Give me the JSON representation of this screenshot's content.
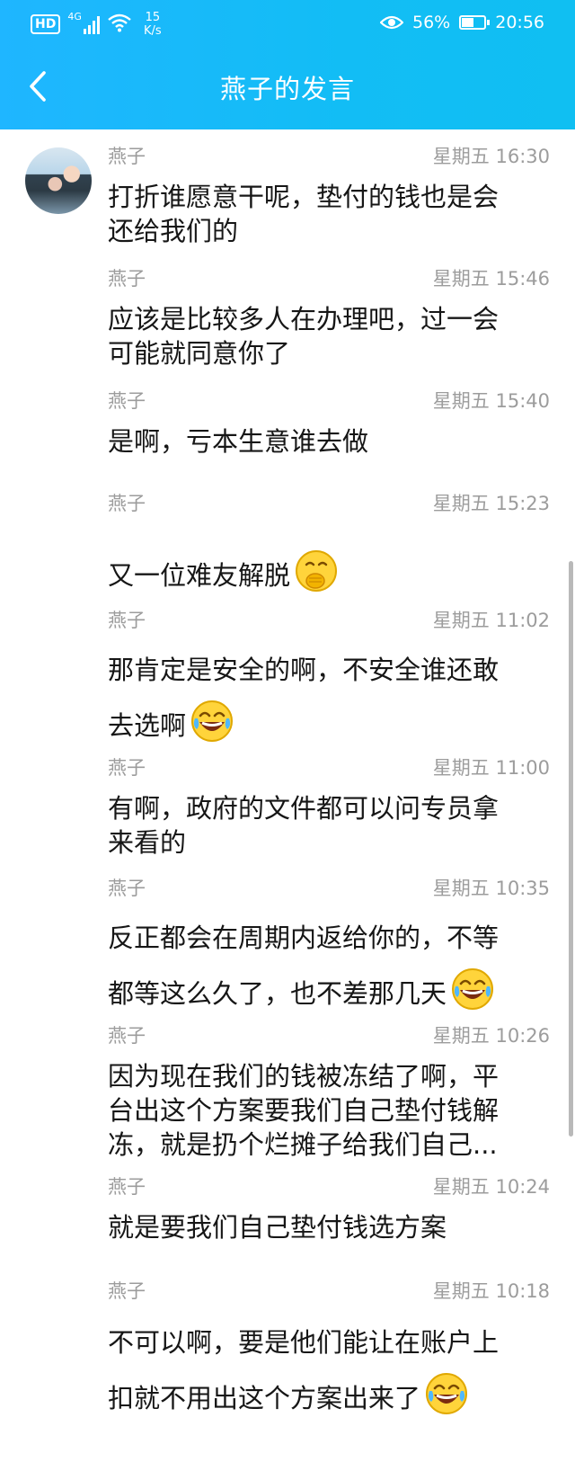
{
  "status_bar": {
    "hd_label": "HD",
    "network_type": "4G",
    "speed_value": "15",
    "speed_unit": "K/s",
    "battery_percent": "56%",
    "battery_level": 0.56,
    "time": "20:56"
  },
  "header": {
    "title": "燕子的发言",
    "back_icon": "chevron-left-icon"
  },
  "colors": {
    "header_bg": "#1fb6ff",
    "meta_text": "#9c9c9c",
    "body_text": "#161616"
  },
  "messages": [
    {
      "sender": "燕子",
      "time": "星期五 16:30",
      "lines": [
        "打折谁愿意干呢，垫付的钱也是会",
        "还给我们的"
      ],
      "emoji": null
    },
    {
      "sender": "燕子",
      "time": "星期五 15:46",
      "lines": [
        "应该是比较多人在办理吧，过一会",
        "可能就同意你了"
      ],
      "emoji": null
    },
    {
      "sender": "燕子",
      "time": "星期五 15:40",
      "lines": [
        "是啊，亏本生意谁去做"
      ],
      "emoji": null
    },
    {
      "sender": "燕子",
      "time": "星期五 15:23",
      "lines": [
        "又一位难友解脱"
      ],
      "emoji": "covered-mouth-emoji"
    },
    {
      "sender": "燕子",
      "time": "星期五 11:02",
      "lines": [
        "那肯定是安全的啊，不安全谁还敢",
        "去选啊"
      ],
      "emoji": "laugh-cry-emoji"
    },
    {
      "sender": "燕子",
      "time": "星期五 11:00",
      "lines": [
        "有啊，政府的文件都可以问专员拿",
        "来看的"
      ],
      "emoji": null
    },
    {
      "sender": "燕子",
      "time": "星期五 10:35",
      "lines": [
        "反正都会在周期内返给你的，不等",
        "都等这么久了，也不差那几天"
      ],
      "emoji": "laugh-cry-emoji"
    },
    {
      "sender": "燕子",
      "time": "星期五 10:26",
      "lines": [
        "因为现在我们的钱被冻结了啊，平",
        "台出这个方案要我们自己垫付钱解",
        "冻，就是扔个烂摊子给我们自己..."
      ],
      "emoji": null
    },
    {
      "sender": "燕子",
      "time": "星期五 10:24",
      "lines": [
        "就是要我们自己垫付钱选方案"
      ],
      "emoji": null
    },
    {
      "sender": "燕子",
      "time": "星期五 10:18",
      "lines": [
        "不可以啊，要是他们能让在账户上",
        "扣就不用出这个方案出来了"
      ],
      "emoji": "laugh-cry-emoji"
    }
  ]
}
